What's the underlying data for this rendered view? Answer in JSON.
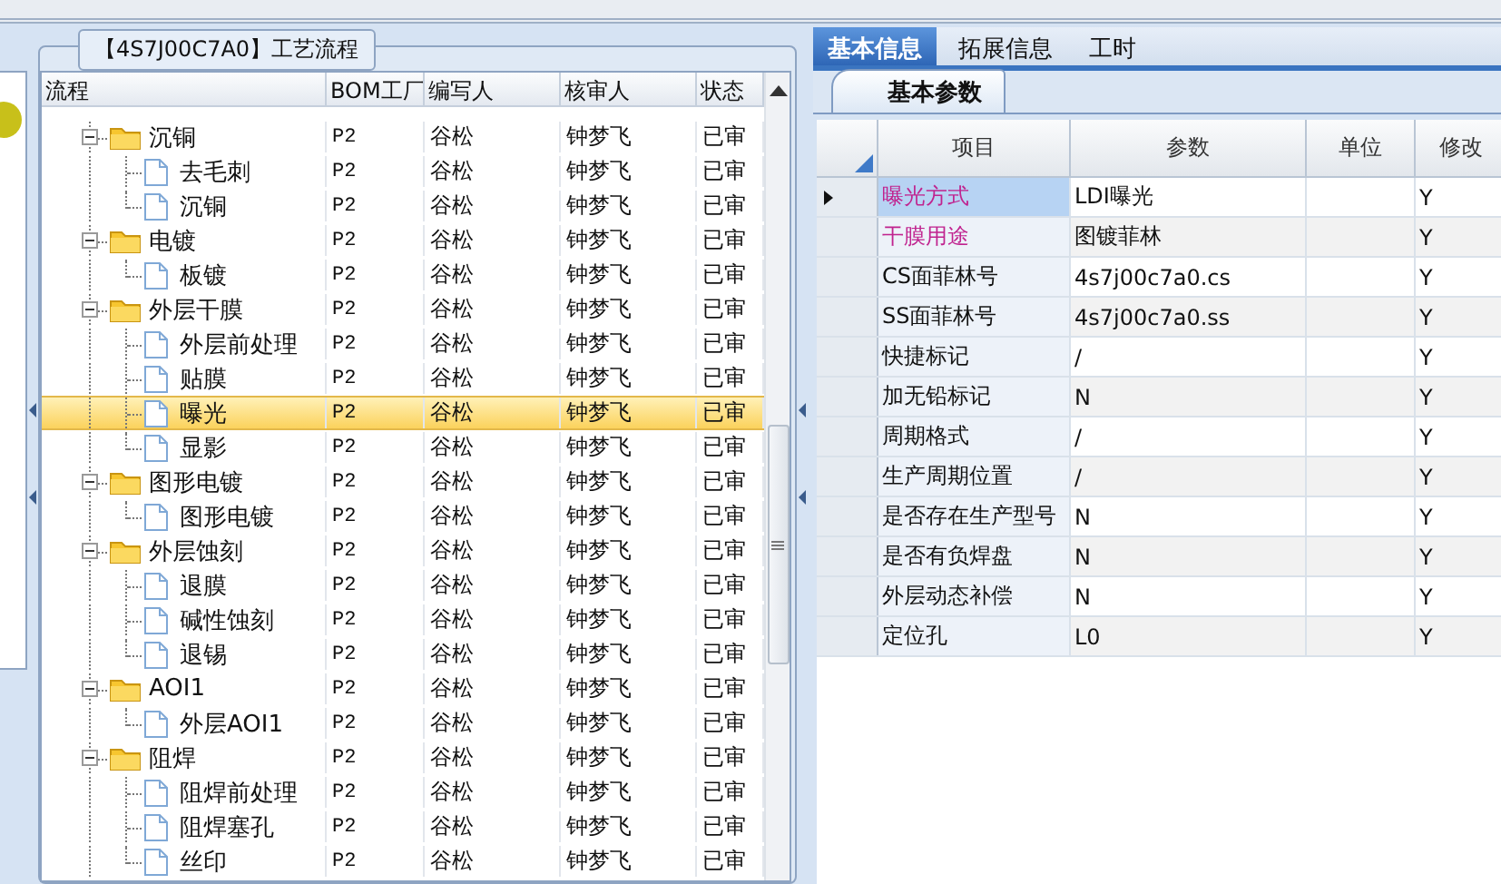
{
  "process_panel": {
    "title": "【4S7J00C7A0】工艺流程",
    "columns": [
      "流程",
      "BOM工厂",
      "编写人",
      "核审人",
      "状态"
    ],
    "tree": [
      {
        "name": "沉铜",
        "bom": "P2",
        "writer": "谷松",
        "reviewer": "钟梦飞",
        "status": "已审",
        "expanded": true,
        "selected": false,
        "children": [
          {
            "name": "去毛刺",
            "bom": "P2",
            "writer": "谷松",
            "reviewer": "钟梦飞",
            "status": "已审",
            "selected": false
          },
          {
            "name": "沉铜",
            "bom": "P2",
            "writer": "谷松",
            "reviewer": "钟梦飞",
            "status": "已审",
            "selected": false
          }
        ]
      },
      {
        "name": "电镀",
        "bom": "P2",
        "writer": "谷松",
        "reviewer": "钟梦飞",
        "status": "已审",
        "expanded": true,
        "selected": false,
        "children": [
          {
            "name": "板镀",
            "bom": "P2",
            "writer": "谷松",
            "reviewer": "钟梦飞",
            "status": "已审",
            "selected": false
          }
        ]
      },
      {
        "name": "外层干膜",
        "bom": "P2",
        "writer": "谷松",
        "reviewer": "钟梦飞",
        "status": "已审",
        "expanded": true,
        "selected": false,
        "children": [
          {
            "name": "外层前处理",
            "bom": "P2",
            "writer": "谷松",
            "reviewer": "钟梦飞",
            "status": "已审",
            "selected": false
          },
          {
            "name": "贴膜",
            "bom": "P2",
            "writer": "谷松",
            "reviewer": "钟梦飞",
            "status": "已审",
            "selected": false
          },
          {
            "name": "曝光",
            "bom": "P2",
            "writer": "谷松",
            "reviewer": "钟梦飞",
            "status": "已审",
            "selected": true
          },
          {
            "name": "显影",
            "bom": "P2",
            "writer": "谷松",
            "reviewer": "钟梦飞",
            "status": "已审",
            "selected": false
          }
        ]
      },
      {
        "name": "图形电镀",
        "bom": "P2",
        "writer": "谷松",
        "reviewer": "钟梦飞",
        "status": "已审",
        "expanded": true,
        "selected": false,
        "children": [
          {
            "name": "图形电镀",
            "bom": "P2",
            "writer": "谷松",
            "reviewer": "钟梦飞",
            "status": "已审",
            "selected": false
          }
        ]
      },
      {
        "name": "外层蚀刻",
        "bom": "P2",
        "writer": "谷松",
        "reviewer": "钟梦飞",
        "status": "已审",
        "expanded": true,
        "selected": false,
        "children": [
          {
            "name": "退膜",
            "bom": "P2",
            "writer": "谷松",
            "reviewer": "钟梦飞",
            "status": "已审",
            "selected": false
          },
          {
            "name": "碱性蚀刻",
            "bom": "P2",
            "writer": "谷松",
            "reviewer": "钟梦飞",
            "status": "已审",
            "selected": false
          },
          {
            "name": "退锡",
            "bom": "P2",
            "writer": "谷松",
            "reviewer": "钟梦飞",
            "status": "已审",
            "selected": false
          }
        ]
      },
      {
        "name": "AOI1",
        "bom": "P2",
        "writer": "谷松",
        "reviewer": "钟梦飞",
        "status": "已审",
        "expanded": true,
        "selected": false,
        "children": [
          {
            "name": "外层AOI1",
            "bom": "P2",
            "writer": "谷松",
            "reviewer": "钟梦飞",
            "status": "已审",
            "selected": false
          }
        ]
      },
      {
        "name": "阻焊",
        "bom": "P2",
        "writer": "谷松",
        "reviewer": "钟梦飞",
        "status": "已审",
        "expanded": true,
        "selected": false,
        "children": [
          {
            "name": "阻焊前处理",
            "bom": "P2",
            "writer": "谷松",
            "reviewer": "钟梦飞",
            "status": "已审",
            "selected": false
          },
          {
            "name": "阻焊塞孔",
            "bom": "P2",
            "writer": "谷松",
            "reviewer": "钟梦飞",
            "status": "已审",
            "selected": false
          },
          {
            "name": "丝印",
            "bom": "P2",
            "writer": "谷松",
            "reviewer": "钟梦飞",
            "status": "已审",
            "selected": false
          }
        ]
      }
    ]
  },
  "detail_panel": {
    "tabs": [
      {
        "label": "基本信息",
        "selected": true
      },
      {
        "label": "拓展信息",
        "selected": false
      },
      {
        "label": "工时",
        "selected": false
      }
    ],
    "subtabs": [
      {
        "label": "基本参数",
        "selected": true
      }
    ],
    "columns": [
      "项目",
      "参数",
      "单位",
      "修改"
    ],
    "rows": [
      {
        "item": "曝光方式",
        "value": "LDI曝光",
        "modify": "Y",
        "emphasized": true,
        "selected": true
      },
      {
        "item": "干膜用途",
        "value": "图镀菲林",
        "modify": "Y",
        "emphasized": true,
        "selected": false
      },
      {
        "item": "CS面菲林号",
        "value": "4s7j00c7a0.cs",
        "modify": "Y",
        "emphasized": false,
        "selected": false
      },
      {
        "item": "SS面菲林号",
        "value": "4s7j00c7a0.ss",
        "modify": "Y",
        "emphasized": false,
        "selected": false
      },
      {
        "item": "快捷标记",
        "value": "/",
        "modify": "Y",
        "emphasized": false,
        "selected": false
      },
      {
        "item": "加无铅标记",
        "value": "N",
        "modify": "Y",
        "emphasized": false,
        "selected": false
      },
      {
        "item": "周期格式",
        "value": "/",
        "modify": "Y",
        "emphasized": false,
        "selected": false
      },
      {
        "item": "生产周期位置",
        "value": "/",
        "modify": "Y",
        "emphasized": false,
        "selected": false
      },
      {
        "item": "是否存在生产型号",
        "value": "N",
        "modify": "Y",
        "emphasized": false,
        "selected": false
      },
      {
        "item": "是否有负焊盘",
        "value": "N",
        "modify": "Y",
        "emphasized": false,
        "selected": false
      },
      {
        "item": "外层动态补偿",
        "value": "N",
        "modify": "Y",
        "emphasized": false,
        "selected": false
      },
      {
        "item": "定位孔",
        "value": "L0",
        "modify": "Y",
        "emphasized": false,
        "selected": false
      }
    ]
  }
}
